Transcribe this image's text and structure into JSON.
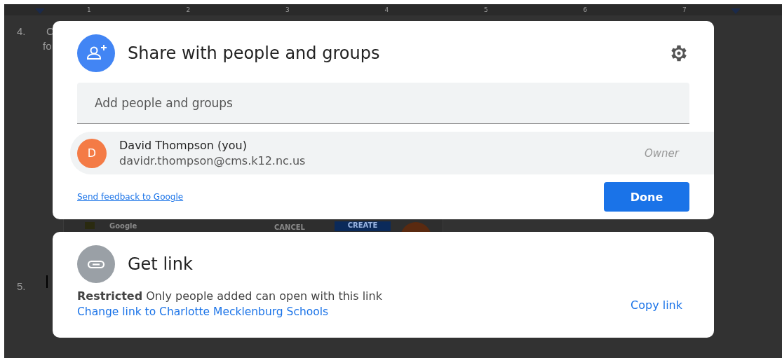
{
  "ruler": {
    "numbers": [
      "1",
      "2",
      "3",
      "4",
      "5",
      "6",
      "7"
    ]
  },
  "document": {
    "items": [
      {
        "number": "4.",
        "text": "C",
        "second_line": "fo"
      },
      {
        "number": "5."
      }
    ],
    "embedded_dialog": {
      "brand": "Google",
      "cancel": "CANCEL",
      "create": "CREATE"
    }
  },
  "share_dialog": {
    "title": "Share with people and groups",
    "field": {
      "placeholder": "Add people and groups"
    },
    "people": [
      {
        "initial": "D",
        "color": "#f47b46",
        "name": "David Thompson (you)",
        "email": "davidr.thompson@cms.k12.nc.us",
        "role": "Owner"
      }
    ],
    "feedback_link": "Send feedback to Google",
    "done_button": "Done"
  },
  "link_dialog": {
    "title": "Get link",
    "access": "**Restricted** Only people added can open with this link",
    "change_link": "Change link to Charlotte Mecklenburg Schools",
    "copy_link": "Copy link"
  }
}
